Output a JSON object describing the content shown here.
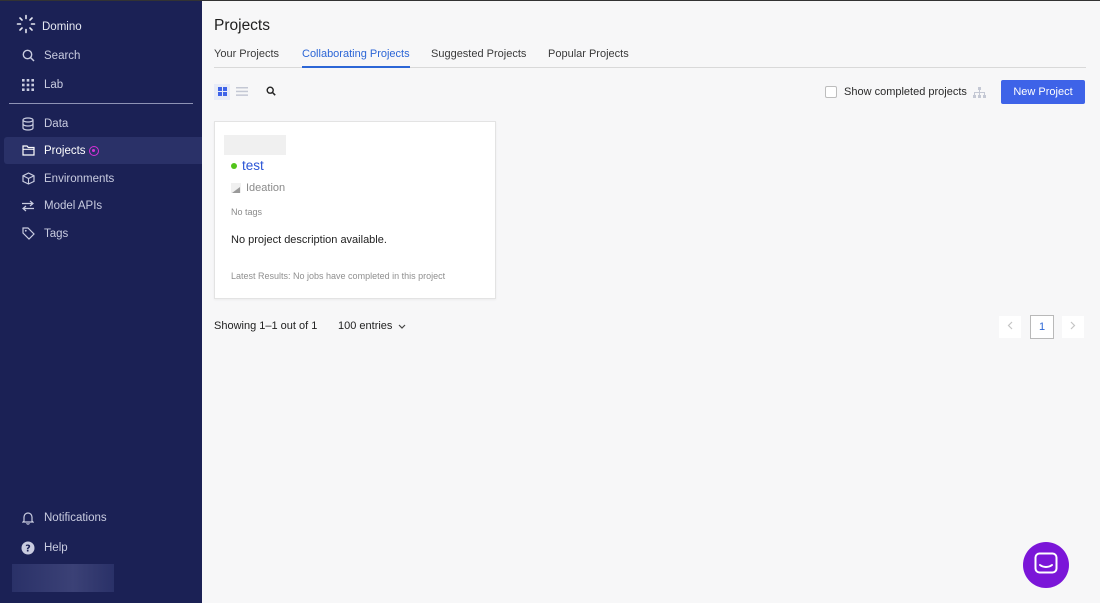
{
  "app": {
    "brand": "Domino"
  },
  "sidebar": {
    "items": [
      {
        "label": "Search"
      },
      {
        "label": "Lab"
      },
      {
        "label": "Data"
      },
      {
        "label": "Projects"
      },
      {
        "label": "Environments"
      },
      {
        "label": "Model APIs"
      },
      {
        "label": "Tags"
      },
      {
        "label": "Notifications"
      },
      {
        "label": "Help"
      }
    ]
  },
  "page": {
    "title": "Projects",
    "tabs": [
      {
        "label": "Your Projects"
      },
      {
        "label": "Collaborating Projects",
        "active": true
      },
      {
        "label": "Suggested Projects"
      },
      {
        "label": "Popular Projects"
      }
    ]
  },
  "toolbar": {
    "show_completed_label": "Show completed projects",
    "show_completed_checked": false,
    "new_project_label": "New Project"
  },
  "colors": {
    "sidebar_bg": "#1b2155",
    "accent": "#3e63e8",
    "active_tab": "#2c66d6",
    "status_active": "#52c41a",
    "badge": "#d631d8",
    "chat": "#7b16d8"
  },
  "project_card": {
    "name": "test",
    "stage": "Ideation",
    "tags": "No tags",
    "description": "No project description available.",
    "latest_results": "Latest Results: No jobs have completed in this project"
  },
  "pagination": {
    "showing": "Showing 1–1 out of 1",
    "entries": "100 entries",
    "current_page": "1"
  },
  "icons": [
    "domino-logo-icon",
    "search-icon",
    "grid-icon",
    "database-icon",
    "folder-icon",
    "cube-icon",
    "arrows-icon",
    "tag-icon",
    "bell-icon",
    "help-icon",
    "grid-view-icon",
    "list-view-icon",
    "hierarchy-icon",
    "chevron-down-icon",
    "chevron-left-icon",
    "chevron-right-icon",
    "chat-icon"
  ]
}
